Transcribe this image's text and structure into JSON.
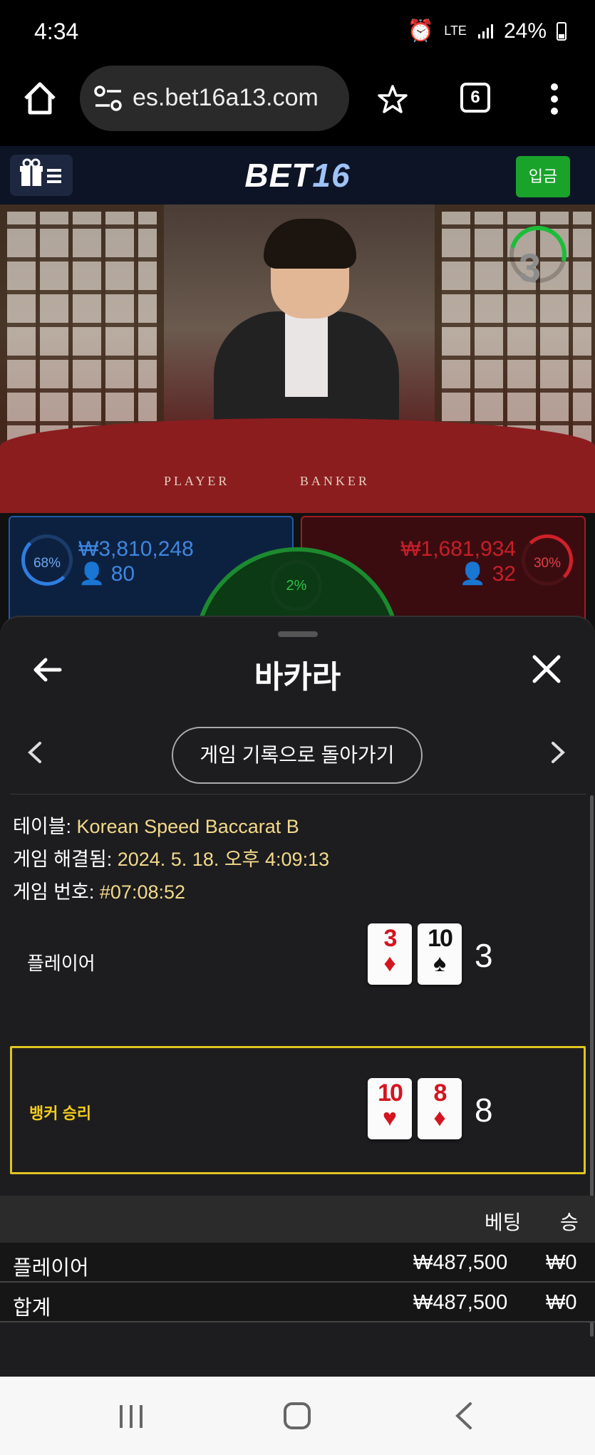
{
  "status_bar": {
    "time": "4:34",
    "net_label": "LTE",
    "battery": "24%"
  },
  "browser": {
    "url": "es.bet16a13.com",
    "tab_count": "6"
  },
  "site": {
    "logo_text": "BET",
    "logo_num": "16",
    "deposit_label": "입금"
  },
  "video": {
    "table_player": "PLAYER",
    "table_banker": "BANKER",
    "countdown": "3"
  },
  "bets": {
    "player_pct": "68%",
    "player_amount": "₩3,810,248",
    "player_count": "80",
    "tie_pct": "2%",
    "banker_pct": "30%",
    "banker_amount": "₩1,681,934",
    "banker_count": "32"
  },
  "modal": {
    "title": "바카라",
    "return_label": "게임 기록으로 돌아가기",
    "table_label": "테이블:",
    "table_value": "Korean Speed Baccarat B",
    "resolved_label": "게임 해결됨:",
    "resolved_value": "2024. 5. 18. 오후 4:09:13",
    "game_no_label": "게임 번호:",
    "game_no_value": "#07:08:52",
    "player_row": {
      "label": "플레이어",
      "cards": [
        {
          "rank": "3",
          "suit": "♦",
          "color": "red"
        },
        {
          "rank": "10",
          "suit": "♠",
          "color": "black"
        }
      ],
      "score": "3"
    },
    "banker_row": {
      "label": "뱅커 승리",
      "cards": [
        {
          "rank": "10",
          "suit": "♥",
          "color": "red"
        },
        {
          "rank": "8",
          "suit": "♦",
          "color": "red"
        }
      ],
      "score": "8"
    },
    "table_headers": {
      "bet": "베팅",
      "win": "승"
    },
    "rows": [
      {
        "name": "플레이어",
        "bet": "₩487,500",
        "win": "₩0"
      },
      {
        "name": "합계",
        "bet": "₩487,500",
        "win": "₩0"
      }
    ]
  },
  "colors": {
    "winner_highlight": "#e0c420",
    "deposit_green": "#1aa32b",
    "player_blue": "#2f7de0",
    "banker_red": "#d0202a"
  }
}
